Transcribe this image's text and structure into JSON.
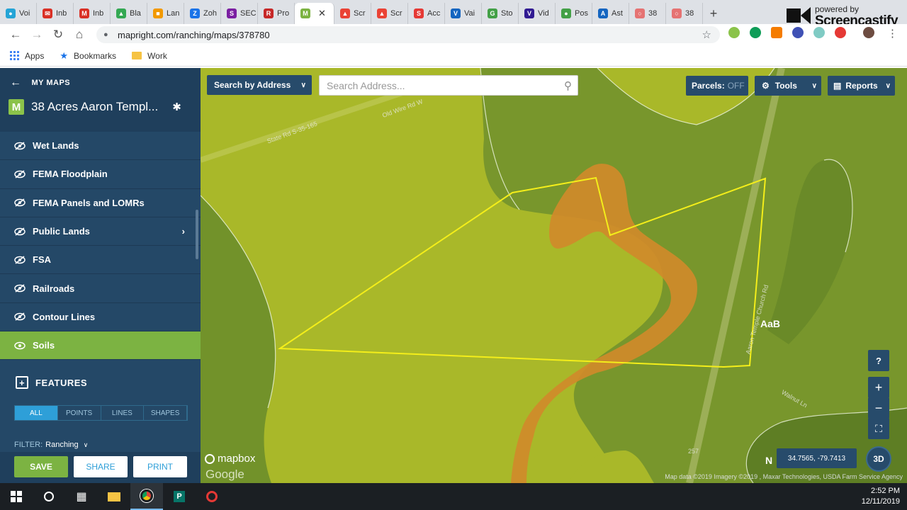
{
  "browser": {
    "tabs": [
      {
        "label": "Voi",
        "color": "#25a4d6",
        "glyph": "●"
      },
      {
        "label": "Inb",
        "color": "#d93025",
        "glyph": "✉"
      },
      {
        "label": "Inb",
        "color": "#d93025",
        "glyph": "M"
      },
      {
        "label": "Bla",
        "color": "#34a853",
        "glyph": "▲"
      },
      {
        "label": "Lan",
        "color": "#f29900",
        "glyph": "■"
      },
      {
        "label": "Zoh",
        "color": "#1a73e8",
        "glyph": "Z"
      },
      {
        "label": "SEC",
        "color": "#7b1fa2",
        "glyph": "S"
      },
      {
        "label": "Pro",
        "color": "#c62828",
        "glyph": "R"
      },
      {
        "label": "",
        "color": "#7cb342",
        "glyph": "M",
        "active": true
      },
      {
        "label": "Scr",
        "color": "#ea4335",
        "glyph": "▲"
      },
      {
        "label": "Scr",
        "color": "#ea4335",
        "glyph": "▲"
      },
      {
        "label": "Acc",
        "color": "#e53935",
        "glyph": "S"
      },
      {
        "label": "Vai",
        "color": "#1565c0",
        "glyph": "V"
      },
      {
        "label": "Sto",
        "color": "#43a047",
        "glyph": "G"
      },
      {
        "label": "Vid",
        "color": "#311b92",
        "glyph": "V"
      },
      {
        "label": "Pos",
        "color": "#43a047",
        "glyph": "●"
      },
      {
        "label": "Ast",
        "color": "#1565c0",
        "glyph": "A"
      },
      {
        "label": "38",
        "color": "#e57373",
        "glyph": "○"
      },
      {
        "label": "38",
        "color": "#e57373",
        "glyph": "○"
      }
    ],
    "url": "mapright.com/ranching/maps/378780",
    "watermark_top": "powered by",
    "watermark_brand": "Screencastify",
    "bookmarks": [
      {
        "label": "Apps",
        "icon": "apps-grid-icon"
      },
      {
        "label": "Bookmarks",
        "icon": "star-icon"
      },
      {
        "label": "Work",
        "icon": "folder-icon"
      }
    ]
  },
  "sidebar": {
    "back_label": "MY MAPS",
    "map_name": "38 Acres Aaron Templ...",
    "layers": [
      {
        "label": "Wet Lands",
        "active": false,
        "has_submenu": false
      },
      {
        "label": "FEMA Floodplain",
        "active": false,
        "has_submenu": false
      },
      {
        "label": "FEMA Panels and LOMRs",
        "active": false,
        "has_submenu": false
      },
      {
        "label": "Public Lands",
        "active": false,
        "has_submenu": true
      },
      {
        "label": "FSA",
        "active": false,
        "has_submenu": false
      },
      {
        "label": "Railroads",
        "active": false,
        "has_submenu": false
      },
      {
        "label": "Contour Lines",
        "active": false,
        "has_submenu": false
      },
      {
        "label": "Soils",
        "active": true,
        "has_submenu": false
      }
    ],
    "features_title": "FEATURES",
    "feature_tabs": [
      "ALL",
      "POINTS",
      "LINES",
      "SHAPES"
    ],
    "filter_label": "FILTER:",
    "filter_value": "Ranching",
    "footer": {
      "save": "SAVE",
      "share": "SHARE",
      "print": "PRINT"
    }
  },
  "map": {
    "search_mode": "Search by Address",
    "search_placeholder": "Search Address...",
    "parcels_label": "Parcels:",
    "parcels_state": "OFF",
    "tools_label": "Tools",
    "reports_label": "Reports",
    "soil_labels": [
      "AaB",
      "N"
    ],
    "coords": "34.7565, -79.7413",
    "three_d": "3D",
    "mapbox_label": "mapbox",
    "google_label": "Google",
    "attribution": "Map data ©2019 Imagery ©2019 , Maxar Technologies, USDA Farm Service Agency",
    "road_labels": [
      "Old Wire Rd W",
      "State Rd S-35-165",
      "Aaron Temple Church Rd",
      "Walnut Ln",
      "257"
    ]
  },
  "taskbar": {
    "time": "2:52 PM",
    "date": "12/11/2019"
  },
  "colors": {
    "sidebar_bg": "#244867",
    "accent_green": "#7cb342",
    "accent_blue": "#2e9fd8",
    "soil_yellow": "#a9b829",
    "soil_green": "#6f8f2a",
    "soil_orange": "#d08a2a",
    "boundary": "#f4ee1a"
  }
}
